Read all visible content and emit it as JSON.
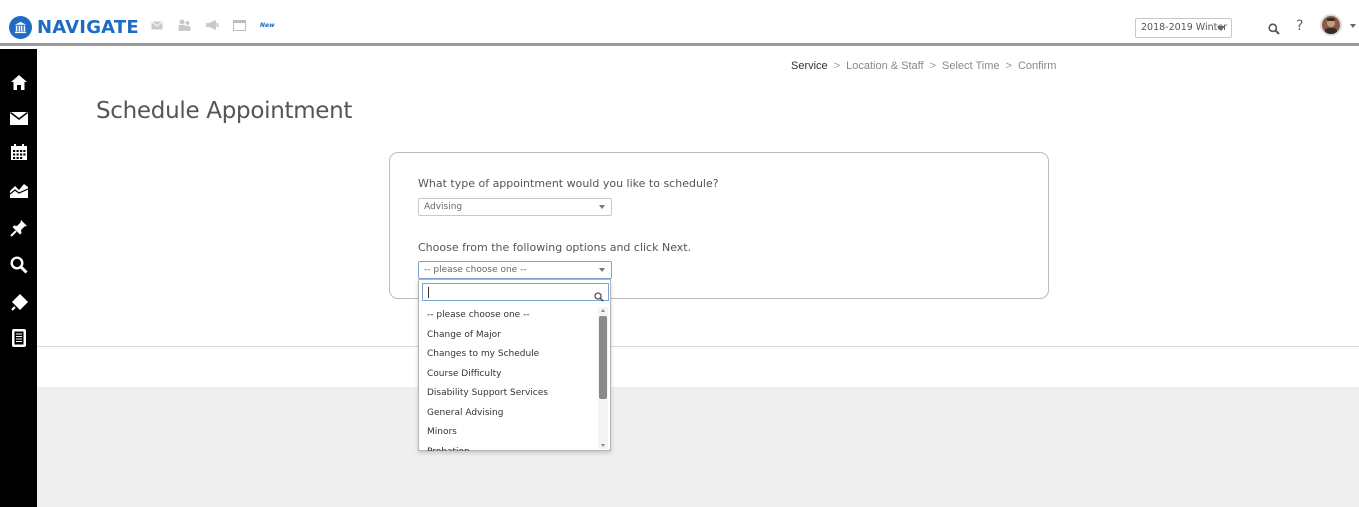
{
  "header": {
    "brand": "NAVIGATE",
    "new_badge": "New",
    "term": "2018-2019 Winter",
    "help": "?",
    "icons": [
      "mail-icon",
      "people-icon",
      "megaphone-icon",
      "calendar-window-icon"
    ]
  },
  "sidebar": {
    "items": [
      "home-icon",
      "mail-icon",
      "calendar-icon",
      "chart-icon",
      "pin-icon",
      "search-icon",
      "tag-icon",
      "document-icon"
    ]
  },
  "breadcrumb": {
    "steps": [
      "Service",
      "Location & Staff",
      "Select Time",
      "Confirm"
    ],
    "separator": ">"
  },
  "page": {
    "title": "Schedule Appointment"
  },
  "form": {
    "question1": "What type of appointment would you like to schedule?",
    "appointment_type": "Advising",
    "question2": "Choose from the following options and click Next.",
    "options_selected": "-- please choose one --"
  },
  "dropdown": {
    "search_value": "",
    "items": [
      "-- please choose one --",
      "Change of Major",
      "Changes to my Schedule",
      "Course Difficulty",
      "Disability Support Services",
      "General Advising",
      "Minors",
      "Probation"
    ]
  },
  "colors": {
    "brand": "#1d6bc3",
    "sidebar": "#000000",
    "band": "#efefef"
  }
}
